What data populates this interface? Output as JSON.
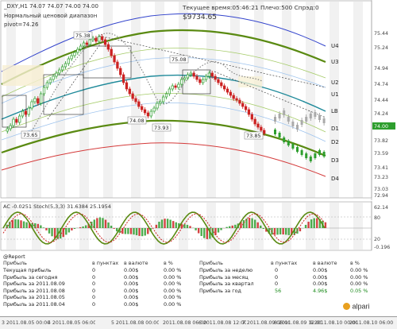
{
  "symbol_line": "_DXY,H1  74.07 74.07 74.00 74.00",
  "indicator_title": "Нормальный ценовой диапазон",
  "pivot_label": "pivot=74.26",
  "status_line": "Текущее время:05:46:21 Плечо:500 Спрэд:0",
  "balance": "$9734.65",
  "price_labels": {
    "p1": "75.38",
    "p2": "75.08",
    "p3": "74.08",
    "p4": "73.93",
    "p5": "73.85",
    "p6": "73.65"
  },
  "band_labels": [
    "U4",
    "U3",
    "U2",
    "U1",
    "LB",
    "D1",
    "D2",
    "D3",
    "D4"
  ],
  "price_axis": {
    "ticks": [
      "75.44",
      "75.24",
      "74.94",
      "74.74",
      "74.44",
      "74.24",
      "74.00",
      "73.82",
      "73.59",
      "73.41",
      "73.23",
      "73.03",
      "72.94"
    ],
    "current_price": "74.00"
  },
  "time_axis": [
    "3 2011.08.05 00:00",
    "4 2011.08.05 06:00",
    "5 2011.08.08 00:00",
    "2011.08.08 06:00",
    "6 2011.08.08 12:00",
    "7 2011.08.09 06:00",
    "8 2011.08.09 12:00",
    "9 2011.08.10 00:00",
    "2011.08.10 06:00"
  ],
  "ac_panel": {
    "title": "AC -0.0251  Stoch(5,3,3) 31.6384 25.1954",
    "axis": [
      "62.14",
      "80",
      "20",
      "-0.196"
    ]
  },
  "report": {
    "title": "@Report",
    "headers_left": [
      "Прибыль",
      "в пунктах",
      "в валюте",
      "в %"
    ],
    "headers_right": [
      "Прибыль",
      "в пунктах",
      "в валюте",
      "в %"
    ],
    "rows_left": [
      {
        "label": "Текущая прибыль",
        "points": "0",
        "money": "0.00$",
        "pct": "0.00 %"
      },
      {
        "label": "Прибыль за сегодня",
        "points": "0",
        "money": "0.00$",
        "pct": "0.00 %"
      },
      {
        "label": "Прибыль за 2011.08.09",
        "points": "0",
        "money": "0.00$",
        "pct": "0.00 %"
      },
      {
        "label": "Прибыль за 2011.08.08",
        "points": "0",
        "money": "0.00$",
        "pct": "0.00 %"
      },
      {
        "label": "Прибыль за 2011.08.05",
        "points": "0",
        "money": "0.00$",
        "pct": "0.00 %"
      },
      {
        "label": "Прибыль за 2011.08.04",
        "points": "0",
        "money": "0.00$",
        "pct": "0.00 %"
      }
    ],
    "rows_right": [
      {
        "label": "Прибыль за неделю",
        "points": "0",
        "money": "0.00$",
        "pct": "0.00 %"
      },
      {
        "label": "Прибыль за месяц",
        "points": "0",
        "money": "0.00$",
        "pct": "0.00 %"
      },
      {
        "label": "Прибыль за квартал",
        "points": "0",
        "money": "0.00$",
        "pct": "0.00 %"
      },
      {
        "label": "Прибыль за год",
        "points": "56",
        "money": "4.96$",
        "pct": "0.05 %"
      }
    ]
  },
  "logo": "alpari",
  "colors": {
    "bull_candle": "#2e9e2e",
    "bear_candle": "#cc2222",
    "band_green": "#5a8a12",
    "band_blue": "#3344cc",
    "band_red": "#d43a3a",
    "band_teal": "#1f8a9a",
    "stripe_fill": "#ebebeb"
  }
}
